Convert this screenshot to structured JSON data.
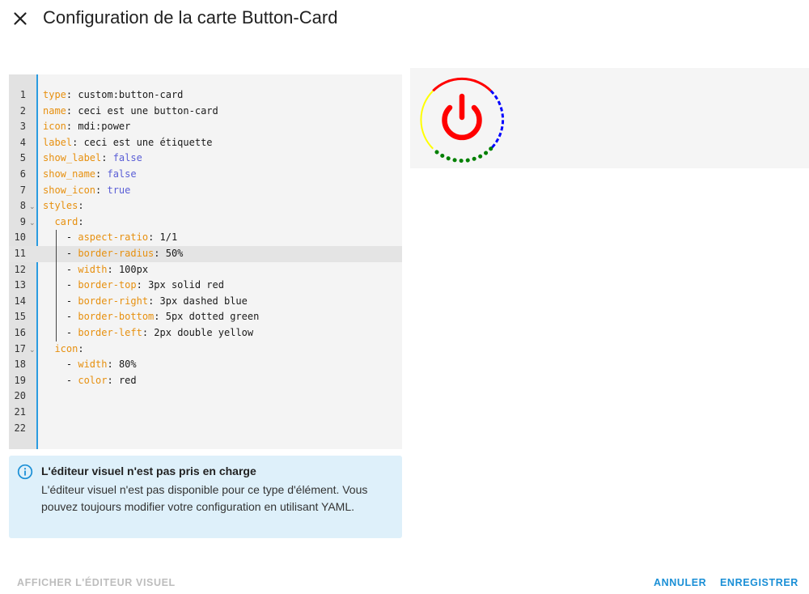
{
  "dialog": {
    "title": "Configuration de la carte Button-Card",
    "close_icon": "close-icon"
  },
  "editor": {
    "active_line": 11,
    "line_numbers": [
      "1",
      "2",
      "3",
      "4",
      "5",
      "6",
      "7",
      "8",
      "9",
      "10",
      "11",
      "12",
      "13",
      "14",
      "15",
      "16",
      "17",
      "18",
      "19",
      "20",
      "21",
      "22"
    ],
    "lines": [
      {
        "indent": "",
        "dash": "",
        "key": "type",
        "colon": ": ",
        "value": "custom:button-card",
        "value_type": "plain"
      },
      {
        "indent": "",
        "dash": "",
        "key": "name",
        "colon": ": ",
        "value": "ceci est une button-card",
        "value_type": "plain"
      },
      {
        "indent": "",
        "dash": "",
        "key": "icon",
        "colon": ": ",
        "value": "mdi:power",
        "value_type": "plain"
      },
      {
        "indent": "",
        "dash": "",
        "key": "label",
        "colon": ": ",
        "value": "ceci est une étiquette",
        "value_type": "plain"
      },
      {
        "indent": "",
        "dash": "",
        "key": "show_label",
        "colon": ": ",
        "value": "false",
        "value_type": "bool"
      },
      {
        "indent": "",
        "dash": "",
        "key": "show_name",
        "colon": ": ",
        "value": "false",
        "value_type": "bool"
      },
      {
        "indent": "",
        "dash": "",
        "key": "show_icon",
        "colon": ": ",
        "value": "true",
        "value_type": "bool"
      },
      {
        "indent": "",
        "dash": "",
        "key": "styles",
        "colon": ":",
        "value": "",
        "value_type": "plain"
      },
      {
        "indent": "  ",
        "dash": "",
        "key": "card",
        "colon": ":",
        "value": "",
        "value_type": "plain"
      },
      {
        "indent": "    ",
        "dash": "- ",
        "key": "aspect-ratio",
        "colon": ": ",
        "value": "1/1",
        "value_type": "plain"
      },
      {
        "indent": "    ",
        "dash": "- ",
        "key": "border-radius",
        "colon": ": ",
        "value": "50%",
        "value_type": "plain"
      },
      {
        "indent": "    ",
        "dash": "- ",
        "key": "width",
        "colon": ": ",
        "value": "100px",
        "value_type": "plain"
      },
      {
        "indent": "    ",
        "dash": "- ",
        "key": "border-top",
        "colon": ": ",
        "value": "3px solid red",
        "value_type": "plain"
      },
      {
        "indent": "    ",
        "dash": "- ",
        "key": "border-right",
        "colon": ": ",
        "value": "3px dashed blue",
        "value_type": "plain"
      },
      {
        "indent": "    ",
        "dash": "- ",
        "key": "border-bottom",
        "colon": ": ",
        "value": "5px dotted green",
        "value_type": "plain"
      },
      {
        "indent": "    ",
        "dash": "- ",
        "key": "border-left",
        "colon": ": ",
        "value": "2px double yellow",
        "value_type": "plain"
      },
      {
        "indent": "  ",
        "dash": "",
        "key": "icon",
        "colon": ":",
        "value": "",
        "value_type": "plain"
      },
      {
        "indent": "    ",
        "dash": "- ",
        "key": "width",
        "colon": ": ",
        "value": "80%",
        "value_type": "plain"
      },
      {
        "indent": "    ",
        "dash": "- ",
        "key": "color",
        "colon": ": ",
        "value": "red",
        "value_type": "plain"
      },
      {
        "indent": "",
        "dash": "",
        "key": "",
        "colon": "",
        "value": "",
        "value_type": "plain"
      },
      {
        "indent": "",
        "dash": "",
        "key": "",
        "colon": "",
        "value": "",
        "value_type": "plain"
      },
      {
        "indent": "",
        "dash": "",
        "key": "",
        "colon": "",
        "value": "",
        "value_type": "plain"
      }
    ],
    "fold_lines": [
      8,
      9,
      17
    ],
    "fold_icon": "chevron-down-icon",
    "colors": {
      "key": "#e7900f",
      "bool": "#5a5ed6",
      "accent": "#2a9be0"
    }
  },
  "info": {
    "icon": "info-icon",
    "title": "L'éditeur visuel n'est pas pris en charge",
    "text": "L'éditeur visuel n'est pas disponible pour ce type d'élément. Vous pouvez toujours modifier votre configuration en utilisant YAML."
  },
  "preview": {
    "icon": "power-icon",
    "icon_color": "#ff0000",
    "border_colors": {
      "top": "#ff0000",
      "right": "#0000ff",
      "bottom": "#008000",
      "left": "#ffff00"
    }
  },
  "footer": {
    "show_visual_editor": "AFFICHER L'ÉDITEUR VISUEL",
    "cancel": "ANNULER",
    "save": "ENREGISTRER"
  }
}
